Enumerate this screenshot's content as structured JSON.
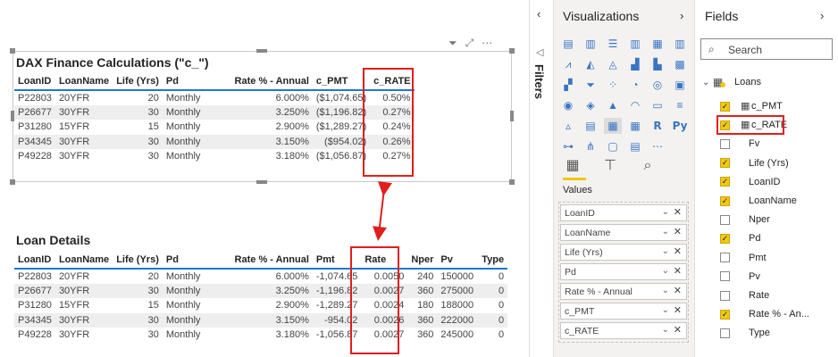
{
  "report": {
    "visual1": {
      "title": "DAX Finance Calculations (\"c_\")",
      "columns": [
        "LoanID",
        "LoanName",
        "Life (Yrs)",
        "Pd",
        "Rate % - Annual",
        "c_PMT",
        "c_RATE"
      ],
      "rows": [
        [
          "P22803",
          "20YFR",
          "20",
          "Monthly",
          "6.000%",
          "($1,074.65)",
          "0.50%"
        ],
        [
          "P26677",
          "30YFR",
          "30",
          "Monthly",
          "3.250%",
          "($1,196.82)",
          "0.27%"
        ],
        [
          "P31280",
          "15YFR",
          "15",
          "Monthly",
          "2.900%",
          "($1,289.27)",
          "0.24%"
        ],
        [
          "P34345",
          "30YFR",
          "30",
          "Monthly",
          "3.150%",
          "($954.02)",
          "0.26%"
        ],
        [
          "P49228",
          "30YFR",
          "30",
          "Monthly",
          "3.180%",
          "($1,056.87)",
          "0.27%"
        ]
      ]
    },
    "visual2": {
      "title": "Loan Details",
      "columns": [
        "LoanID",
        "LoanName",
        "Life (Yrs)",
        "Pd",
        "Rate % - Annual",
        "Pmt",
        "Rate",
        "Nper",
        "Pv",
        "Type"
      ],
      "rows": [
        [
          "P22803",
          "20YFR",
          "20",
          "Monthly",
          "6.000%",
          "-1,074.65",
          "0.0050",
          "240",
          "150000",
          "0"
        ],
        [
          "P26677",
          "30YFR",
          "30",
          "Monthly",
          "3.250%",
          "-1,196.82",
          "0.0027",
          "360",
          "275000",
          "0"
        ],
        [
          "P31280",
          "15YFR",
          "15",
          "Monthly",
          "2.900%",
          "-1,289.27",
          "0.0024",
          "180",
          "188000",
          "0"
        ],
        [
          "P34345",
          "30YFR",
          "30",
          "Monthly",
          "3.150%",
          "-954.02",
          "0.0026",
          "360",
          "222000",
          "0"
        ],
        [
          "P49228",
          "30YFR",
          "30",
          "Monthly",
          "3.180%",
          "-1,056.87",
          "0.0027",
          "360",
          "245000",
          "0"
        ]
      ]
    },
    "visual_header_icons": [
      "filter-icon",
      "focus-mode-icon",
      "more-options-icon"
    ],
    "highlight_color": "#e01e1e",
    "header_rule_color": "#1f77d0"
  },
  "filters": {
    "label": "Filters"
  },
  "visualizations": {
    "title": "Visualizations",
    "values_label": "Values",
    "wells": [
      "LoanID",
      "LoanName",
      "Life (Yrs)",
      "Pd",
      "Rate % - Annual",
      "c_PMT",
      "c_RATE"
    ],
    "tabs": [
      "fields-tab",
      "format-tab",
      "analytics-tab"
    ],
    "gallery_text_icons": [
      "R",
      "Py"
    ]
  },
  "fields": {
    "title": "Fields",
    "search_placeholder": "Search",
    "table_name": "Loans",
    "items": [
      {
        "name": "c_PMT",
        "checked": true,
        "calc": true
      },
      {
        "name": "c_RATE",
        "checked": true,
        "calc": true
      },
      {
        "name": "Fv",
        "checked": false,
        "calc": false
      },
      {
        "name": "Life (Yrs)",
        "checked": true,
        "calc": false
      },
      {
        "name": "LoanID",
        "checked": true,
        "calc": false
      },
      {
        "name": "LoanName",
        "checked": true,
        "calc": false
      },
      {
        "name": "Nper",
        "checked": false,
        "calc": false
      },
      {
        "name": "Pd",
        "checked": true,
        "calc": false
      },
      {
        "name": "Pmt",
        "checked": false,
        "calc": false
      },
      {
        "name": "Pv",
        "checked": false,
        "calc": false
      },
      {
        "name": "Rate",
        "checked": false,
        "calc": false
      },
      {
        "name": "Rate % - An...",
        "checked": true,
        "calc": false
      },
      {
        "name": "Type",
        "checked": false,
        "calc": false
      }
    ],
    "accent_color": "#f2c811"
  }
}
